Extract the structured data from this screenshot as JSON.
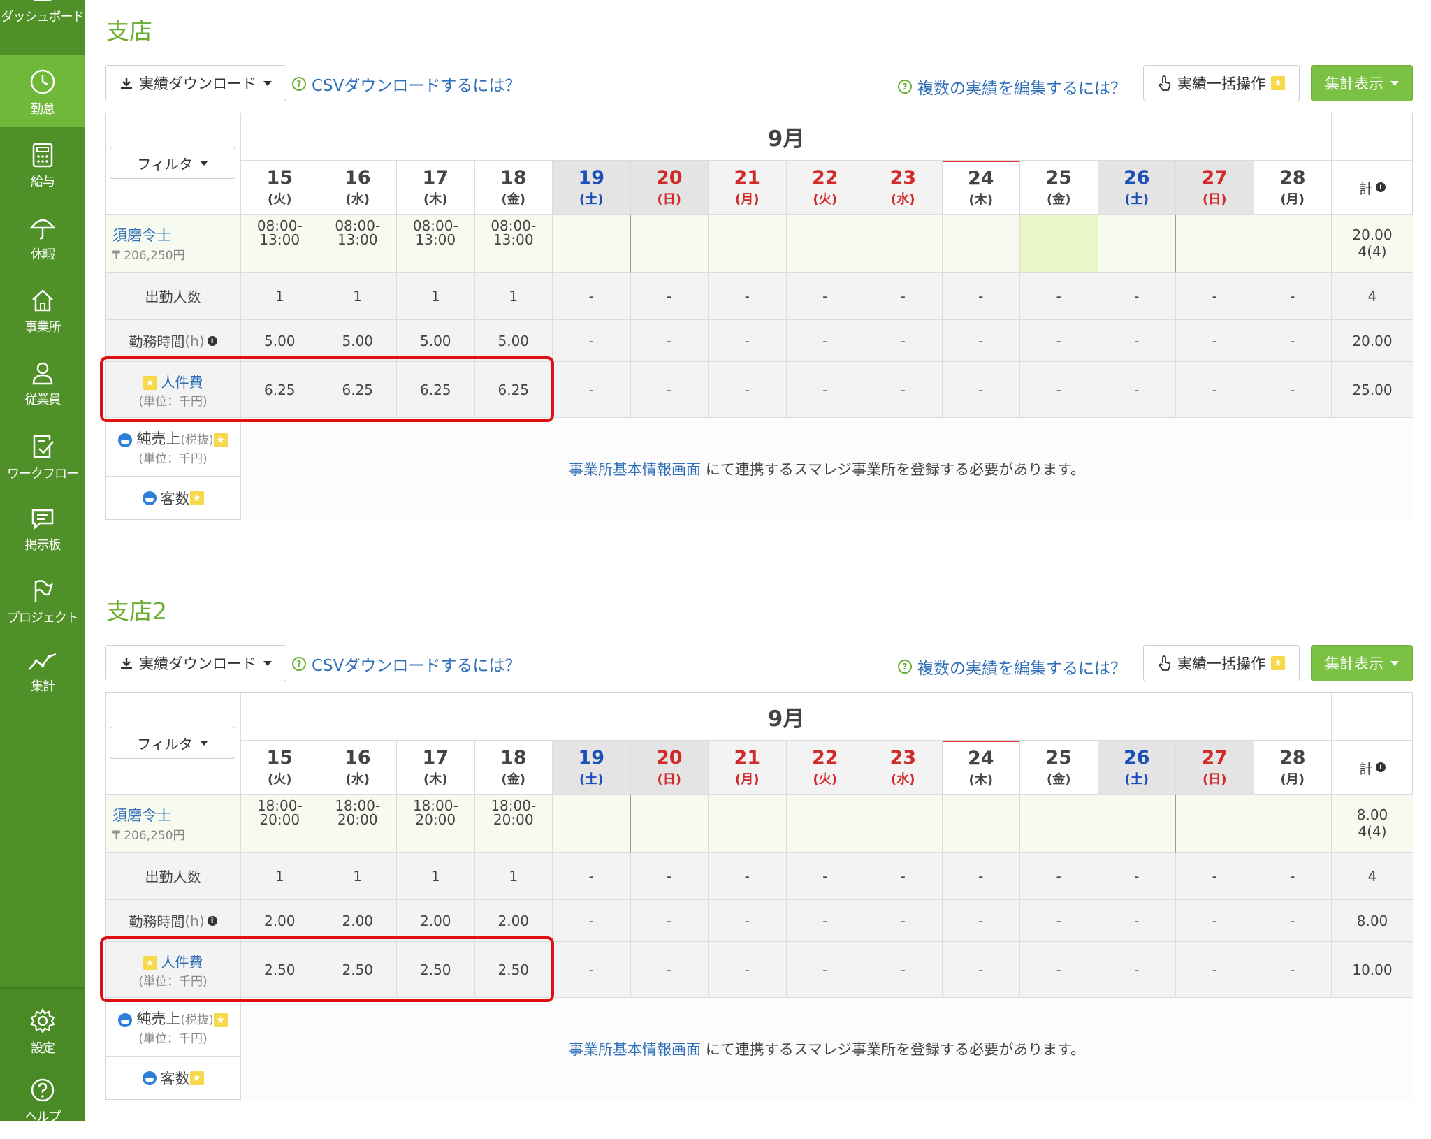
{
  "sidebar": {
    "items": [
      {
        "label": "ダッシュボード",
        "icon": "grid-icon"
      },
      {
        "label": "勤怠",
        "icon": "clock-icon",
        "active": true
      },
      {
        "label": "給与",
        "icon": "calculator-icon"
      },
      {
        "label": "休暇",
        "icon": "umbrella-icon"
      },
      {
        "label": "事業所",
        "icon": "home-icon"
      },
      {
        "label": "従業員",
        "icon": "user-icon"
      },
      {
        "label": "ワークフロー",
        "icon": "clipboard-check-icon"
      },
      {
        "label": "掲示板",
        "icon": "chat-icon"
      },
      {
        "label": "プロジェクト",
        "icon": "flag-icon"
      },
      {
        "label": "集計",
        "icon": "line-chart-icon"
      }
    ],
    "bottom": [
      {
        "label": "設定",
        "icon": "gear-icon"
      },
      {
        "label": "ヘルプ",
        "icon": "help-icon"
      }
    ]
  },
  "toolbar": {
    "download_label": "実績ダウンロード",
    "csv_help": "CSVダウンロードするには？",
    "edit_help": "複数の実績を編集するには？",
    "bulk_label": "実績一括操作",
    "summary_label": "集計表示"
  },
  "table_common": {
    "month": "9月",
    "filter_label": "フィルタ",
    "total_label": "計",
    "days": [
      {
        "num": "15",
        "dow": "(火)",
        "type": "normal"
      },
      {
        "num": "16",
        "dow": "(水)",
        "type": "normal"
      },
      {
        "num": "17",
        "dow": "(木)",
        "type": "normal"
      },
      {
        "num": "18",
        "dow": "(金)",
        "type": "normal"
      },
      {
        "num": "19",
        "dow": "(土)",
        "type": "sat"
      },
      {
        "num": "20",
        "dow": "(日)",
        "type": "sun"
      },
      {
        "num": "21",
        "dow": "(月)",
        "type": "holiday"
      },
      {
        "num": "22",
        "dow": "(火)",
        "type": "holiday"
      },
      {
        "num": "23",
        "dow": "(水)",
        "type": "holiday"
      },
      {
        "num": "24",
        "dow": "(木)",
        "type": "today"
      },
      {
        "num": "25",
        "dow": "(金)",
        "type": "normal"
      },
      {
        "num": "26",
        "dow": "(土)",
        "type": "sat"
      },
      {
        "num": "27",
        "dow": "(日)",
        "type": "sun"
      },
      {
        "num": "28",
        "dow": "(月)",
        "type": "normal"
      }
    ],
    "row_labels": {
      "attendance": "出勤人数",
      "hours": "勤務時間",
      "hours_unit": "(h)",
      "labor": "人件費",
      "labor_unit": "(単位：千円)",
      "sales": "純売上",
      "sales_tax": "(税抜)",
      "sales_unit": "(単位：千円)",
      "customers": "客数"
    },
    "note_link": "事業所基本情報画面",
    "note_text": "にて連携するスマレジ事業所を登録する必要があります。"
  },
  "sections": [
    {
      "title": "支店",
      "employee": {
        "name": "須磨令士",
        "pay": "₸ 206,250円"
      },
      "shifts": [
        [
          "08:00-",
          "13:00"
        ],
        [
          "08:00-",
          "13:00"
        ],
        [
          "08:00-",
          "13:00"
        ],
        [
          "08:00-",
          "13:00"
        ]
      ],
      "employee_total": [
        "20.00",
        "4(4)"
      ],
      "attendance": [
        "1",
        "1",
        "1",
        "1",
        "-",
        "-",
        "-",
        "-",
        "-",
        "-",
        "-",
        "-",
        "-",
        "-"
      ],
      "attendance_total": "4",
      "hours": [
        "5.00",
        "5.00",
        "5.00",
        "5.00",
        "-",
        "-",
        "-",
        "-",
        "-",
        "-",
        "-",
        "-",
        "-",
        "-"
      ],
      "hours_total": "20.00",
      "labor": [
        "6.25",
        "6.25",
        "6.25",
        "6.25",
        "-",
        "-",
        "-",
        "-",
        "-",
        "-",
        "-",
        "-",
        "-",
        "-"
      ],
      "labor_total": "25.00"
    },
    {
      "title": "支店2",
      "employee": {
        "name": "須磨令士",
        "pay": "₸ 206,250円"
      },
      "shifts": [
        [
          "18:00-",
          "20:00"
        ],
        [
          "18:00-",
          "20:00"
        ],
        [
          "18:00-",
          "20:00"
        ],
        [
          "18:00-",
          "20:00"
        ]
      ],
      "employee_total": [
        "8.00",
        "4(4)"
      ],
      "attendance": [
        "1",
        "1",
        "1",
        "1",
        "-",
        "-",
        "-",
        "-",
        "-",
        "-",
        "-",
        "-",
        "-",
        "-"
      ],
      "attendance_total": "4",
      "hours": [
        "2.00",
        "2.00",
        "2.00",
        "2.00",
        "-",
        "-",
        "-",
        "-",
        "-",
        "-",
        "-",
        "-",
        "-",
        "-"
      ],
      "hours_total": "8.00",
      "labor": [
        "2.50",
        "2.50",
        "2.50",
        "2.50",
        "-",
        "-",
        "-",
        "-",
        "-",
        "-",
        "-",
        "-",
        "-",
        "-"
      ],
      "labor_total": "10.00"
    }
  ],
  "colors": {
    "sidebar": "#4f9128",
    "sidebar_active": "#6fb83a",
    "accent": "#6cae33",
    "link": "#2f6fb8",
    "saturday": "#1d4fb8",
    "sunday_holiday": "#d12a2a",
    "highlight_box": "#e01010"
  }
}
